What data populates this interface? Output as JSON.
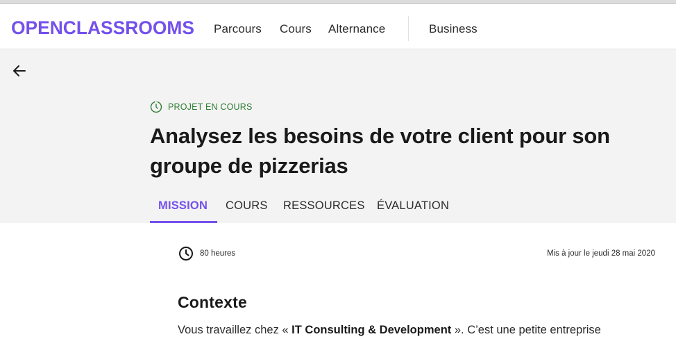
{
  "header": {
    "logo_text": "OPENCLASSROOMS",
    "nav": [
      "Parcours",
      "Cours",
      "Alternance",
      "Business"
    ]
  },
  "colors": {
    "accent": "#7451eb",
    "status_green": "#2e7d32",
    "hero_bg": "#f3f3f3"
  },
  "icons": {
    "back": "arrow-left-icon",
    "status": "timer-icon",
    "duration": "clock-icon"
  },
  "project": {
    "status": "PROJET EN COURS",
    "title_line1": "Analysez les besoins de votre client pour son",
    "title_line2": "groupe de pizzerias"
  },
  "tabs": [
    "MISSION",
    "COURS",
    "RESSOURCES",
    "ÉVALUATION"
  ],
  "active_tab": "MISSION",
  "meta": {
    "duration": "80 heures",
    "updated": "Mis à jour le jeudi 28 mai 2020"
  },
  "content": {
    "section_title": "Contexte",
    "paragraph_start": "Vous travaillez chez « ",
    "company": "IT Consulting & Development",
    "paragraph_end": " ». C’est une petite entreprise"
  }
}
